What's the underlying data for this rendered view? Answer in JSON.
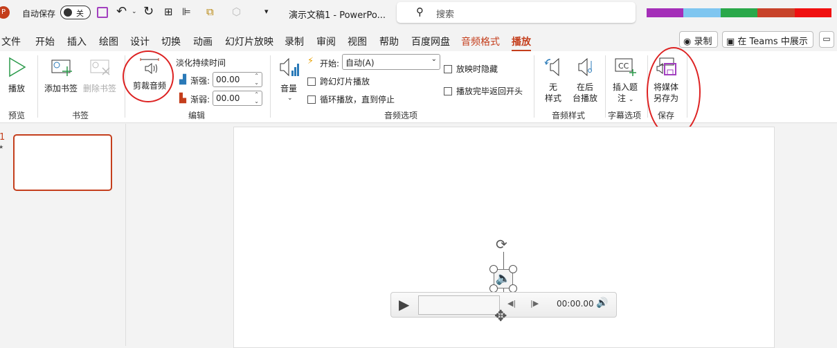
{
  "titlebar": {
    "autosave_label": "自动保存",
    "autosave_state": "关",
    "doc_title": "演示文稿1  -  PowerPo...",
    "search_placeholder": "搜索"
  },
  "tabs": [
    "文件",
    "开始",
    "插入",
    "绘图",
    "设计",
    "切换",
    "动画",
    "幻灯片放映",
    "录制",
    "审阅",
    "视图",
    "帮助",
    "百度网盘",
    "音频格式",
    "播放"
  ],
  "right_buttons": {
    "record": "录制",
    "teams": "在 Teams 中展示"
  },
  "ribbon": {
    "preview": {
      "play": "播放",
      "group": "预览"
    },
    "bookmarks": {
      "add": "添加书签",
      "remove": "删除书签",
      "group": "书签"
    },
    "editing": {
      "trim": "剪裁音频",
      "fade_title": "淡化持续时间",
      "fade_in_label": "渐强:",
      "fade_in_value": "00.00",
      "fade_out_label": "渐弱:",
      "fade_out_value": "00.00",
      "group": "编辑"
    },
    "audio_options": {
      "volume": "音量",
      "start_label": "开始:",
      "start_value": "自动(A)",
      "play_across": "跨幻灯片播放",
      "loop": "循环播放，直到停止",
      "hide": "放映时隐藏",
      "rewind": "播放完毕返回开头",
      "group": "音频选项"
    },
    "audio_styles": {
      "no_style_1": "无",
      "no_style_2": "样式",
      "background_1": "在后",
      "background_2": "台播放",
      "group": "音频样式"
    },
    "captions": {
      "insert_1": "插入题",
      "insert_2": "注",
      "group": "字幕选项"
    },
    "save": {
      "save_as_1": "将媒体",
      "save_as_2": "另存为",
      "group": "保存"
    }
  },
  "slides": {
    "number": "1",
    "star": "★"
  },
  "player": {
    "time": "00:00.00"
  },
  "colors": {
    "accent": "#c43e1c",
    "annotation": "#d22222"
  }
}
